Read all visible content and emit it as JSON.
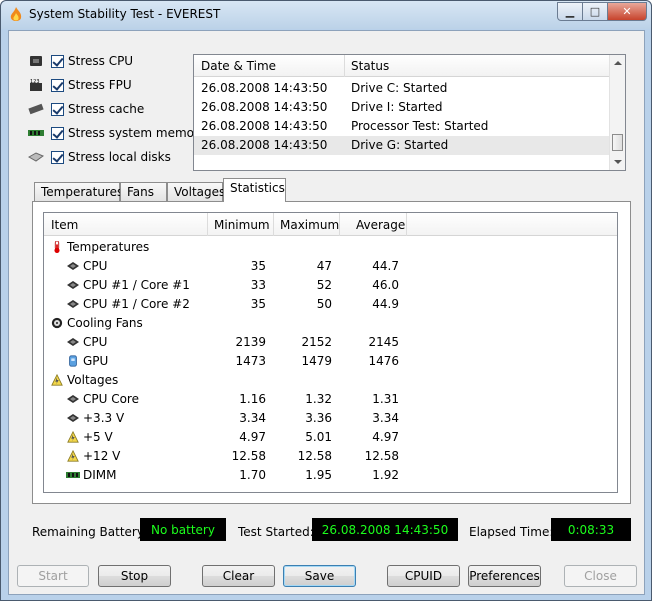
{
  "window": {
    "title": "System Stability Test - EVEREST"
  },
  "stress_options": [
    {
      "label": "Stress CPU",
      "checked": true,
      "icon": "cpu-chip-icon"
    },
    {
      "label": "Stress FPU",
      "checked": true,
      "icon": "fpu-123-icon"
    },
    {
      "label": "Stress cache",
      "checked": true,
      "icon": "cache-chip-icon"
    },
    {
      "label": "Stress system memory",
      "checked": true,
      "icon": "memory-module-icon"
    },
    {
      "label": "Stress local disks",
      "checked": true,
      "icon": "disk-drive-icon"
    }
  ],
  "log": {
    "columns": [
      "Date & Time",
      "Status"
    ],
    "rows": [
      {
        "time": "26.08.2008 14:43:50",
        "status": "Drive C: Started"
      },
      {
        "time": "26.08.2008 14:43:50",
        "status": "Drive I: Started"
      },
      {
        "time": "26.08.2008 14:43:50",
        "status": "Processor Test: Started"
      },
      {
        "time": "26.08.2008 14:43:50",
        "status": "Drive G: Started"
      }
    ]
  },
  "tabs": [
    "Temperatures",
    "Fans",
    "Voltages",
    "Statistics"
  ],
  "active_tab": "Statistics",
  "stats": {
    "columns": [
      "Item",
      "Minimum",
      "Maximum",
      "Average"
    ],
    "groups": [
      {
        "label": "Temperatures",
        "icon": "thermometer-icon",
        "rows": [
          {
            "label": "CPU",
            "min": "35",
            "max": "47",
            "avg": "44.7",
            "icon": "cpu-chip-icon"
          },
          {
            "label": "CPU #1 / Core #1",
            "min": "33",
            "max": "52",
            "avg": "46.0",
            "icon": "cpu-chip-icon"
          },
          {
            "label": "CPU #1 / Core #2",
            "min": "35",
            "max": "50",
            "avg": "44.9",
            "icon": "cpu-chip-icon"
          }
        ]
      },
      {
        "label": "Cooling Fans",
        "icon": "fan-icon",
        "rows": [
          {
            "label": "CPU",
            "min": "2139",
            "max": "2152",
            "avg": "2145",
            "icon": "cpu-chip-icon"
          },
          {
            "label": "GPU",
            "min": "1473",
            "max": "1479",
            "avg": "1476",
            "icon": "gpu-icon"
          }
        ]
      },
      {
        "label": "Voltages",
        "icon": "voltage-warning-icon",
        "rows": [
          {
            "label": "CPU Core",
            "min": "1.16",
            "max": "1.32",
            "avg": "1.31",
            "icon": "cpu-chip-icon"
          },
          {
            "label": "+3.3 V",
            "min": "3.34",
            "max": "3.36",
            "avg": "3.34",
            "icon": "cpu-chip-icon"
          },
          {
            "label": "+5 V",
            "min": "4.97",
            "max": "5.01",
            "avg": "4.97",
            "icon": "voltage-warning-icon"
          },
          {
            "label": "+12 V",
            "min": "12.58",
            "max": "12.58",
            "avg": "12.58",
            "icon": "voltage-warning-icon"
          },
          {
            "label": "DIMM",
            "min": "1.70",
            "max": "1.95",
            "avg": "1.92",
            "icon": "memory-module-icon"
          }
        ]
      }
    ]
  },
  "status": {
    "battery_label": "Remaining Battery:",
    "battery_value": "No battery",
    "started_label": "Test Started:",
    "started_value": "26.08.2008 14:43:50",
    "elapsed_label": "Elapsed Time:",
    "elapsed_value": "0:08:33",
    "lcd_text_color": "#1cff1c"
  },
  "buttons": {
    "start": "Start",
    "stop": "Stop",
    "clear": "Clear",
    "save": "Save",
    "cpuid": "CPUID",
    "preferences": "Preferences",
    "close": "Close"
  }
}
